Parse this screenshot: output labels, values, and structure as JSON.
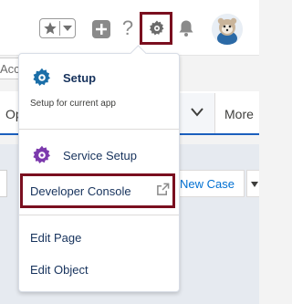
{
  "header": {
    "help_glyph": "?"
  },
  "background": {
    "search_fragment": "Acco",
    "nav_fragment": "Op",
    "nav_more_label": "More",
    "new_case_label": "New Case"
  },
  "setup_menu": {
    "setup_title": "Setup",
    "setup_subtitle": "Setup for current app",
    "items": [
      {
        "label": "Service Setup"
      },
      {
        "label": "Developer Console"
      },
      {
        "label": "Edit Page"
      },
      {
        "label": "Edit Object"
      }
    ]
  },
  "icons": {
    "favorites": "star-icon",
    "global_actions": "plus-icon",
    "help": "help-icon",
    "setup": "gear-icon",
    "notifications": "bell-icon",
    "user": "avatar",
    "external": "external-link-icon"
  },
  "colors": {
    "highlight": "#7a0f1f",
    "setup_icon": "#1a6ea8",
    "service_icon": "#7c3aad",
    "text_primary": "#16325c",
    "link": "#0070d2",
    "icon_gray": "#8a8a8a"
  }
}
